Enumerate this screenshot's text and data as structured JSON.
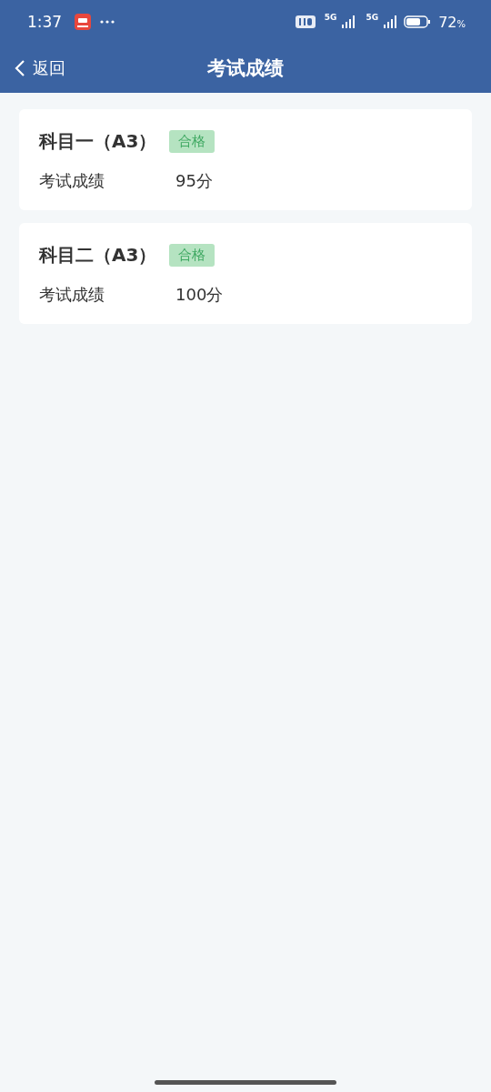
{
  "status_bar": {
    "time": "1:37",
    "network_labels": [
      "5G",
      "5G"
    ],
    "battery": "72",
    "battery_unit": "%"
  },
  "header": {
    "back_label": "返回",
    "title": "考试成绩"
  },
  "results": [
    {
      "subject": "科目一（A3）",
      "badge": "合格",
      "kind": "pass",
      "score_label": "考试成绩",
      "score": "95分"
    },
    {
      "subject": "科目二（A3）",
      "badge": "合格",
      "kind": "pass",
      "score_label": "考试成绩",
      "score": "100分"
    }
  ]
}
